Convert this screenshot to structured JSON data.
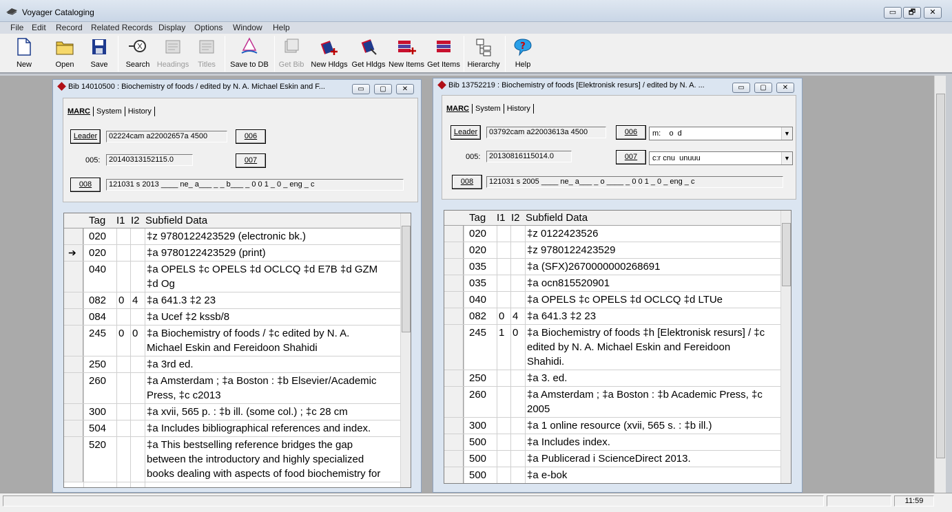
{
  "app": {
    "title": "Voyager Cataloging",
    "minimize": "▭",
    "restore": "🗗",
    "close": "✕"
  },
  "menu": [
    "File",
    "Edit",
    "Record",
    "Related Records",
    "Display",
    "Options",
    "Window",
    "Help"
  ],
  "toolbar": [
    {
      "label": "New",
      "icon": "new-document-icon",
      "enabled": true
    },
    {
      "label": "Open",
      "icon": "open-folder-icon",
      "enabled": true
    },
    {
      "label": "Save",
      "icon": "floppy-disk-icon",
      "enabled": true
    },
    {
      "label": "Search",
      "icon": "search-icon",
      "enabled": true
    },
    {
      "label": "Headings",
      "icon": "headings-icon",
      "enabled": false
    },
    {
      "label": "Titles",
      "icon": "titles-icon",
      "enabled": false
    },
    {
      "label": "Save to DB",
      "icon": "save-to-db-icon",
      "enabled": true
    },
    {
      "label": "Get Bib",
      "icon": "get-bib-icon",
      "enabled": false
    },
    {
      "label": "New Hldgs",
      "icon": "new-holdings-icon",
      "enabled": true
    },
    {
      "label": "Get Hldgs",
      "icon": "get-holdings-icon",
      "enabled": true
    },
    {
      "label": "New Items",
      "icon": "new-items-icon",
      "enabled": true
    },
    {
      "label": "Get Items",
      "icon": "get-items-icon",
      "enabled": true
    },
    {
      "label": "Hierarchy",
      "icon": "hierarchy-icon",
      "enabled": true
    },
    {
      "label": "Help",
      "icon": "help-icon",
      "enabled": true
    }
  ],
  "windows": [
    {
      "title": "Bib 14010500 : Biochemistry of foods / edited by N. A. Michael Eskin and F...",
      "tabs": [
        "MARC",
        "System",
        "History"
      ],
      "leader_label": "Leader",
      "leader": "02224cam a22002657a 4500",
      "f005_label": "005:",
      "f005": "20140313152115.0",
      "btn006": "006",
      "btn007": "007",
      "btn008": "008",
      "f008": "121031  s  2013  ____  ne_  a___  _ _  b___  _ 0 0 1 _ 0 _  eng _  c",
      "headers": {
        "tag": "Tag",
        "i1": "I1",
        "i2": "I2",
        "data": "Subfield Data"
      },
      "rows": [
        {
          "tag": "020",
          "i1": "",
          "i2": "",
          "data": [
            "‡z 9780122423529 (electronic bk.)"
          ]
        },
        {
          "tag": "020",
          "i1": "",
          "i2": "",
          "data": [
            "‡a 9780122423529 (print)"
          ],
          "current": true
        },
        {
          "tag": "040",
          "i1": "",
          "i2": "",
          "data": [
            "‡a OPELS ‡c OPELS ‡d OCLCQ ‡d E7B ‡d GZM",
            "‡d Og"
          ]
        },
        {
          "tag": "082",
          "i1": "0",
          "i2": "4",
          "data": [
            "‡a 641.3 ‡2 23"
          ]
        },
        {
          "tag": "084",
          "i1": "",
          "i2": "",
          "data": [
            "‡a Ucef ‡2 kssb/8"
          ]
        },
        {
          "tag": "245",
          "i1": "0",
          "i2": "0",
          "data": [
            "‡a Biochemistry of foods / ‡c edited by N. A.",
            "Michael Eskin and Fereidoon Shahidi"
          ]
        },
        {
          "tag": "250",
          "i1": "",
          "i2": "",
          "data": [
            "‡a 3rd ed."
          ]
        },
        {
          "tag": "260",
          "i1": "",
          "i2": "",
          "data": [
            "‡a Amsterdam ; ‡a Boston : ‡b Elsevier/Academic",
            "Press, ‡c c2013"
          ]
        },
        {
          "tag": "300",
          "i1": "",
          "i2": "",
          "data": [
            "‡a xvii, 565 p. : ‡b ill. (some col.) ; ‡c 28 cm"
          ]
        },
        {
          "tag": "504",
          "i1": "",
          "i2": "",
          "data": [
            "‡a Includes bibliographical references and index."
          ]
        },
        {
          "tag": "520",
          "i1": "",
          "i2": "",
          "data": [
            "‡a This bestselling reference bridges the gap",
            "between the introductory and highly specialized",
            "books dealing with aspects of food biochemistry for"
          ]
        }
      ]
    },
    {
      "title": "Bib 13752219 : Biochemistry of foods [Elektronisk resurs] / edited by N. A. ...",
      "tabs": [
        "MARC",
        "System",
        "History"
      ],
      "leader_label": "Leader",
      "leader": "03792cam a22003613a 4500",
      "f005_label": "005:",
      "f005": "20130816115014.0",
      "btn006": "006",
      "btn007": "007",
      "f006": "m:    o  d",
      "f007": "c:r cnu  unuuu",
      "btn008": "008",
      "f008": "121031  s  2005  ____  ne_  a___  _  o  ____  _ 0 0 1 _ 0 _  eng _  c",
      "headers": {
        "tag": "Tag",
        "i1": "I1",
        "i2": "I2",
        "data": "Subfield Data"
      },
      "rows": [
        {
          "tag": "020",
          "i1": "",
          "i2": "",
          "data": [
            "‡z 0122423526"
          ]
        },
        {
          "tag": "020",
          "i1": "",
          "i2": "",
          "data": [
            "‡z 9780122423529"
          ]
        },
        {
          "tag": "035",
          "i1": "",
          "i2": "",
          "data": [
            "‡a (SFX)2670000000268691"
          ]
        },
        {
          "tag": "035",
          "i1": "",
          "i2": "",
          "data": [
            "‡a ocn815520901"
          ]
        },
        {
          "tag": "040",
          "i1": "",
          "i2": "",
          "data": [
            "‡a OPELS ‡c OPELS ‡d OCLCQ ‡d LTUe"
          ]
        },
        {
          "tag": "082",
          "i1": "0",
          "i2": "4",
          "data": [
            "‡a 641.3 ‡2 23"
          ]
        },
        {
          "tag": "245",
          "i1": "1",
          "i2": "0",
          "data": [
            "‡a Biochemistry of foods ‡h [Elektronisk resurs] / ‡c",
            "edited by N. A. Michael Eskin and Fereidoon",
            "Shahidi."
          ]
        },
        {
          "tag": "250",
          "i1": "",
          "i2": "",
          "data": [
            "‡a 3. ed."
          ]
        },
        {
          "tag": "260",
          "i1": "",
          "i2": "",
          "data": [
            "‡a Amsterdam ; ‡a Boston : ‡b Academic Press, ‡c",
            "2005"
          ]
        },
        {
          "tag": "300",
          "i1": "",
          "i2": "",
          "data": [
            "‡a 1 online resource (xvii, 565 s. : ‡b ill.)"
          ]
        },
        {
          "tag": "500",
          "i1": "",
          "i2": "",
          "data": [
            "‡a Includes index."
          ]
        },
        {
          "tag": "500",
          "i1": "",
          "i2": "",
          "data": [
            "‡a Publicerad i ScienceDirect 2013."
          ]
        },
        {
          "tag": "500",
          "i1": "",
          "i2": "",
          "data": [
            "‡a e-bok"
          ]
        }
      ]
    }
  ],
  "status": {
    "time": "11:59"
  }
}
